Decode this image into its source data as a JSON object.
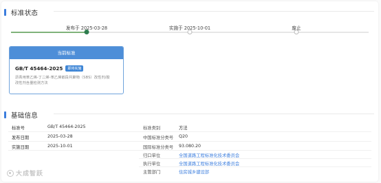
{
  "sections": {
    "status_title": "标准状态",
    "basic_title": "基础信息"
  },
  "timeline": {
    "published": "发布于 2025-03-28",
    "implemented": "实施于 2025-10-01",
    "abolished": "废止"
  },
  "standard_card": {
    "header": "当前标准",
    "code": "GB/T 45464-2025",
    "badge": "即将实施",
    "name_line1": "沥青用苯乙烯-丁二烯-苯乙烯嵌段共聚物（SBS）改性剂/胶",
    "name_line2": "改性剂含量检测方法"
  },
  "basic_info": {
    "left": [
      {
        "label": "标准号",
        "value": "GB/T 45464-2025"
      },
      {
        "label": "发布日期",
        "value": "2025-03-28"
      },
      {
        "label": "实施日期",
        "value": "2025-10-01"
      }
    ],
    "right": [
      {
        "label": "标准类别",
        "value": "方法"
      },
      {
        "label": "中国标准分类号",
        "value": "Q20"
      },
      {
        "label": "国际标准分类号",
        "value": "93.080.20"
      },
      {
        "label": "归口单位",
        "value": "全国道路工程标准化技术委员会"
      },
      {
        "label": "执行单位",
        "value": "全国道路工程标准化技术委员会"
      },
      {
        "label": "主管部门",
        "value": "住房城乡建设部"
      }
    ]
  },
  "watermark": "大成智跃",
  "colors": {
    "accent": "#3b7ddd",
    "card_header": "#4d8ed8",
    "progress": "#7fb27a",
    "dot_done": "#2e7d4f",
    "link": "#3b7ddd"
  }
}
